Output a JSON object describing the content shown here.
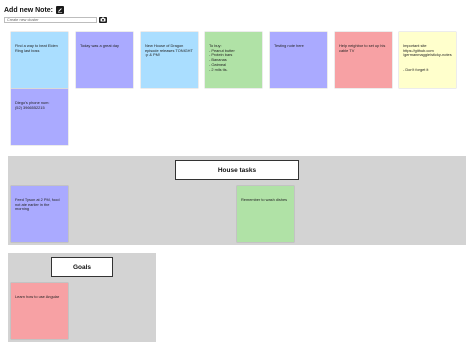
{
  "header": {
    "title": "Add new Note:",
    "add_icon": "edit-icon"
  },
  "cluster_form": {
    "placeholder": "Create new cluster",
    "button_icon": "camera-icon"
  },
  "colors": {
    "blue": "#aaaaff",
    "cyan": "#aadeff",
    "green": "#b0e2a6",
    "pink": "#f7a1a4",
    "yellow": "#ffffcc",
    "cluster_bg": "#d3d3d3"
  },
  "notes": [
    {
      "text": "Find a way to beat Elden Ring last boss",
      "color": "cyan"
    },
    {
      "text": "Today was a great day",
      "color": "blue"
    },
    {
      "text": "New House of Dragon episode releases TONIGHT :p & PM!",
      "color": "cyan"
    },
    {
      "text": "To buy:\n- Peanut butter\n- Protein bars\n- Bananas\n- Oatmeal\n- 2 mils tis.",
      "color": "green"
    },
    {
      "text": "Testing note here",
      "color": "blue"
    },
    {
      "text": "Help neighbor to set up his cable TV",
      "color": "pink"
    },
    {
      "text": "Important site\nhttps://github.com\n/germanmaggie/sticky-notes\n\n\n- Don't forget it",
      "color": "yellow"
    },
    {
      "text": "Diego's phone num:\n(52) 3966552215",
      "color": "blue"
    }
  ],
  "clusters": [
    {
      "title": "House tasks",
      "notes": [
        {
          "text": "Feed Tyson at 2 PM, food not ate earlier in the morning",
          "color": "blue"
        },
        {
          "text": "Remember to wash dishes",
          "color": "green"
        }
      ]
    },
    {
      "title": "Goals",
      "notes": [
        {
          "text": "Learn how to use Angular",
          "color": "pink"
        }
      ]
    }
  ]
}
